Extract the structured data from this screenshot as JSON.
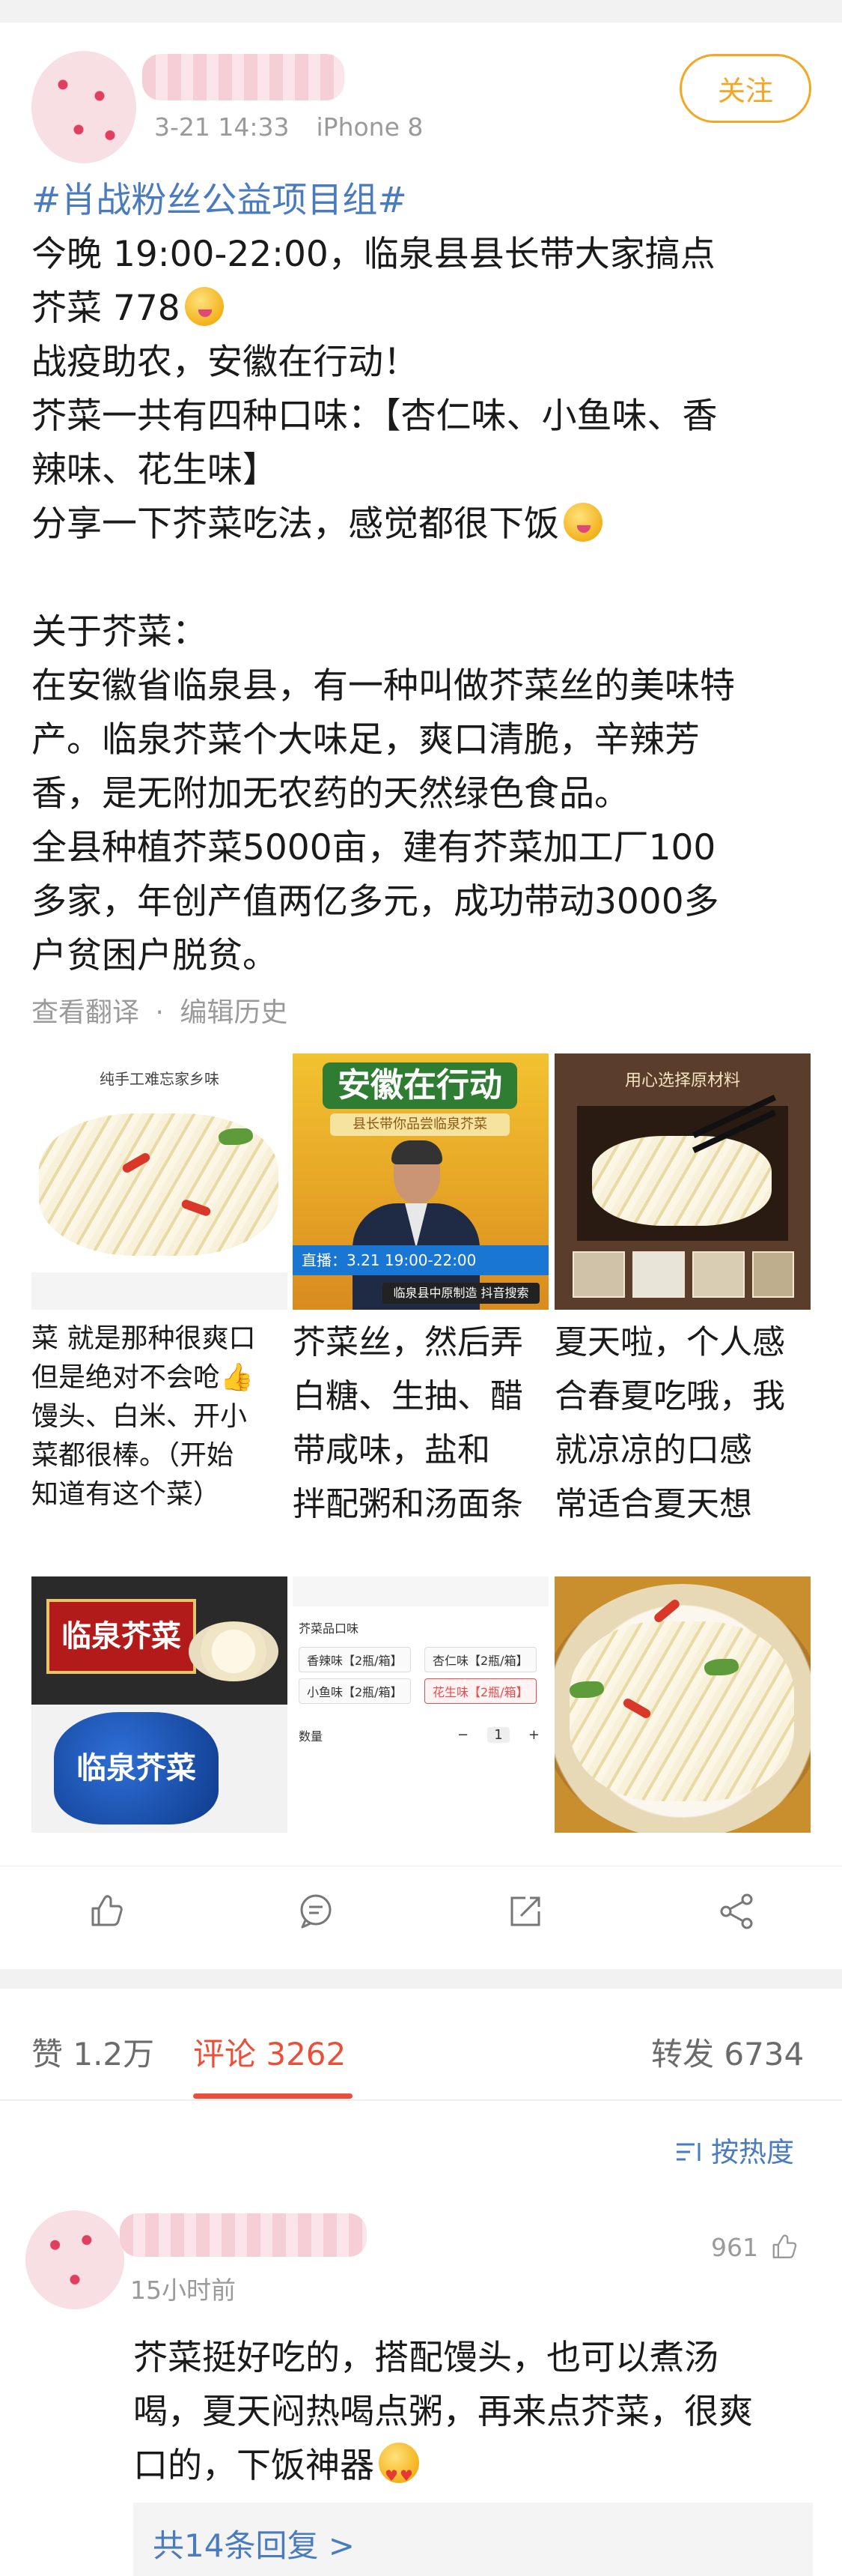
{
  "post": {
    "time": "3-21 14:33",
    "device": "iPhone 8",
    "follow_label": "关注",
    "lines": [
      "#肖战粉丝公益项目组#",
      "今晚 19:00-22:00，临泉县县长带大家搞点",
      "芥菜 778",
      "战疫助农，安徽在行动！",
      "芥菜一共有四种口味：【杏仁味、小鱼味、香",
      "辣味、花生味】",
      "分享一下芥菜吃法，感觉都很下饭",
      "",
      "关于芥菜：",
      "在安徽省临泉县，有一种叫做芥菜丝的美味特",
      "产。临泉芥菜个大味足，爽口清脆，辛辣芳",
      "香，是无附加无农药的天然绿色食品。",
      "全县种植芥菜5000亩，建有芥菜加工厂100",
      "多家，年创产值两亿多元，成功带动3000多",
      "户贫困户脱贫。"
    ],
    "translate_label": "查看翻译",
    "edit_history_label": "编辑历史",
    "separator": "·"
  },
  "images": {
    "img1_caption": "纯手工难忘家乡味",
    "img2_title": "安徽在行动",
    "img2_sub": "县长带你品尝临泉芥菜",
    "img2_live": "直播：3.21 19:00-22:00",
    "img2_bottom": "临泉县中原制造 抖音搜索",
    "img3_title": "用心选择原材料",
    "img4_lines": [
      "菜 就是那种很爽口",
      "但是绝对不会呛",
      "馒头、白米、开小",
      "菜都很棒。（开始",
      "知道有这个菜）"
    ],
    "img5_lines": [
      "芥菜丝，然后弄",
      "白糖、生抽、醋",
      "带咸味，盐和",
      "拌配粥和汤面条"
    ],
    "img6_lines": [
      "夏天啦，个人感",
      "合春夏吃哦，我",
      "就凉凉的口感",
      "常适合夏天想"
    ],
    "img7_label": "临泉芥菜",
    "img7_label2": "临泉芥菜",
    "img8_head": "芥菜品口味",
    "img8_opts": [
      "香辣味【2瓶/箱】",
      "杏仁味【2瓶/箱】",
      "小鱼味【2瓶/箱】",
      "花生味【2瓶/箱】"
    ],
    "img8_qty_label": "数量",
    "img8_minus": "−",
    "img8_qty": "1",
    "img8_plus": "+"
  },
  "toolbar": {
    "like_icon": "thumb-up-icon",
    "comment_icon": "comment-icon",
    "repost_icon": "repost-icon",
    "share_icon": "share-icon"
  },
  "tabs": {
    "likes": "赞 1.2万",
    "comments": "评论 3262",
    "reposts": "转发 6734"
  },
  "sort": {
    "label": "按热度"
  },
  "comment": {
    "time": "15小时前",
    "likes": "961",
    "lines": [
      "芥菜挺好吃的，搭配馒头，也可以煮汤",
      "喝，夏天闷热喝点粥，再来点芥菜，很爽",
      "口的，下饭神器"
    ],
    "replies_label": "共14条回复 >"
  },
  "colors": {
    "accent": "#e8503a",
    "link": "#4a7bbf",
    "follow": "#f5a623"
  }
}
